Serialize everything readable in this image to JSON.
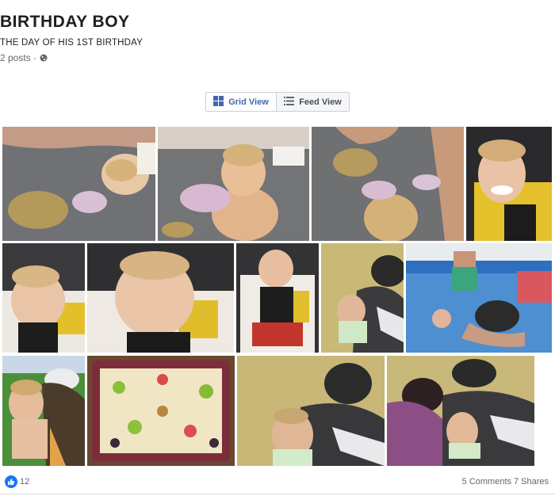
{
  "album": {
    "title": "BIRTHDAY BOY",
    "subtitle": "THE DAY OF HIS 1ST BIRTHDAY",
    "posts": "2 posts ·",
    "privacy_icon": "globe-icon"
  },
  "view_toggle": {
    "grid_label": "Grid View",
    "feed_label": "Feed View",
    "active": "grid",
    "grid_icon": "grid-icon",
    "feed_icon": "list-icon"
  },
  "photos": [
    {
      "subject": "money-floor-1"
    },
    {
      "subject": "money-floor-2"
    },
    {
      "subject": "money-floor-3"
    },
    {
      "subject": "highchair-smile-1"
    },
    {
      "subject": "baby-seat-1"
    },
    {
      "subject": "baby-seat-2"
    },
    {
      "subject": "baby-highchair-red"
    },
    {
      "subject": "man-holding-baby"
    },
    {
      "subject": "pool"
    },
    {
      "subject": "child-holding-baby"
    },
    {
      "subject": "fruit-cake"
    },
    {
      "subject": "man-baby-2"
    },
    {
      "subject": "woman-man-baby"
    }
  ],
  "reactions": {
    "like_icon": "thumbs-up-icon",
    "like_color": "#1877f2",
    "count": "12",
    "comments": "5 Comments",
    "shares": "7 Shares"
  },
  "colors": {
    "accent": "#4267b2",
    "muted_text": "#606770",
    "border": "#ccd0d5"
  }
}
